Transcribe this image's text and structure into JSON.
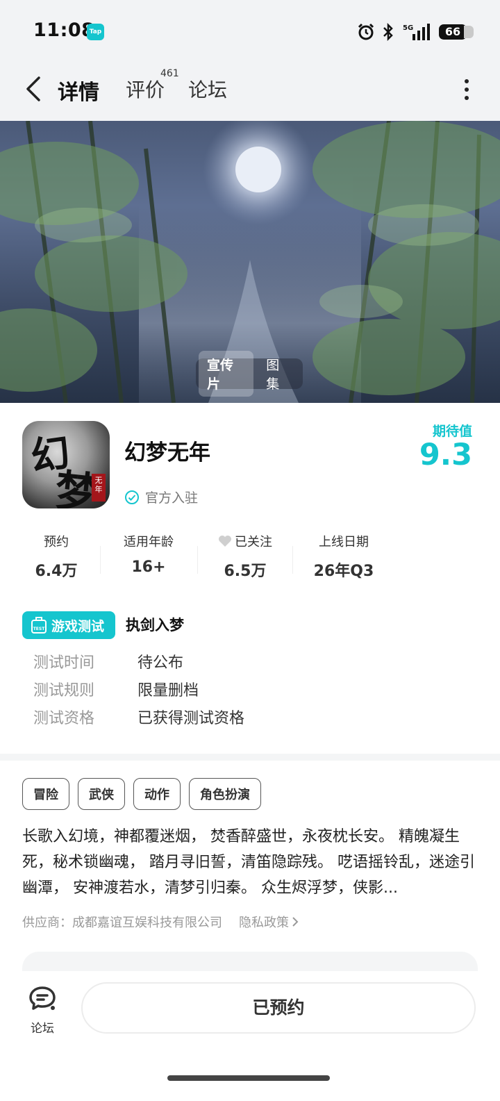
{
  "status_bar": {
    "time": "11:08",
    "app_badge": "Tap",
    "network": "5G",
    "battery": "66"
  },
  "nav": {
    "tabs": [
      {
        "label": "详情",
        "active": true
      },
      {
        "label": "评价",
        "count": "461"
      },
      {
        "label": "论坛"
      }
    ]
  },
  "hero": {
    "media_tabs": [
      "宣传片",
      "图集"
    ],
    "active_media_tab": "宣传片"
  },
  "game": {
    "title": "幻梦无年",
    "icon_text": [
      "幻",
      "梦",
      "无年"
    ],
    "official_label": "官方入驻",
    "expect_label": "期待值",
    "expect_score": "9.3"
  },
  "stats": [
    {
      "label": "预约",
      "value": "6.4万"
    },
    {
      "label": "适用年龄",
      "value": "16+"
    },
    {
      "label": "已关注",
      "value": "6.5万",
      "icon": "heart-icon"
    },
    {
      "label": "上线日期",
      "value": "26年Q3"
    }
  ],
  "test": {
    "badge": "游戏测试",
    "badge_icon_text": "TEST",
    "name": "执剑入梦",
    "rows": [
      {
        "key": "测试时间",
        "value": "待公布"
      },
      {
        "key": "测试规则",
        "value": "限量删档"
      },
      {
        "key": "测试资格",
        "value": "已获得测试资格"
      }
    ]
  },
  "tags": [
    "冒险",
    "武侠",
    "动作",
    "角色扮演"
  ],
  "description": "长歌入幻境，神都覆迷烟， 焚香醉盛世，永夜枕长安。 精魄凝生死，秘术锁幽魂， 踏月寻旧誓，清笛隐踪残。 呓语摇铃乱，迷途引幽潭， 安神渡若水，清梦引归秦。 众生烬浮梦，侠影...",
  "supplier": {
    "text": "供应商：成都嘉谊互娱科技有限公司",
    "privacy": "隐私政策"
  },
  "bottom": {
    "forum_label": "论坛",
    "reserve_label": "已预约"
  },
  "colors": {
    "accent": "#15c5ce",
    "text": "#1f1f1f",
    "muted": "#999999",
    "nav_bg": "#f2f3f5"
  }
}
